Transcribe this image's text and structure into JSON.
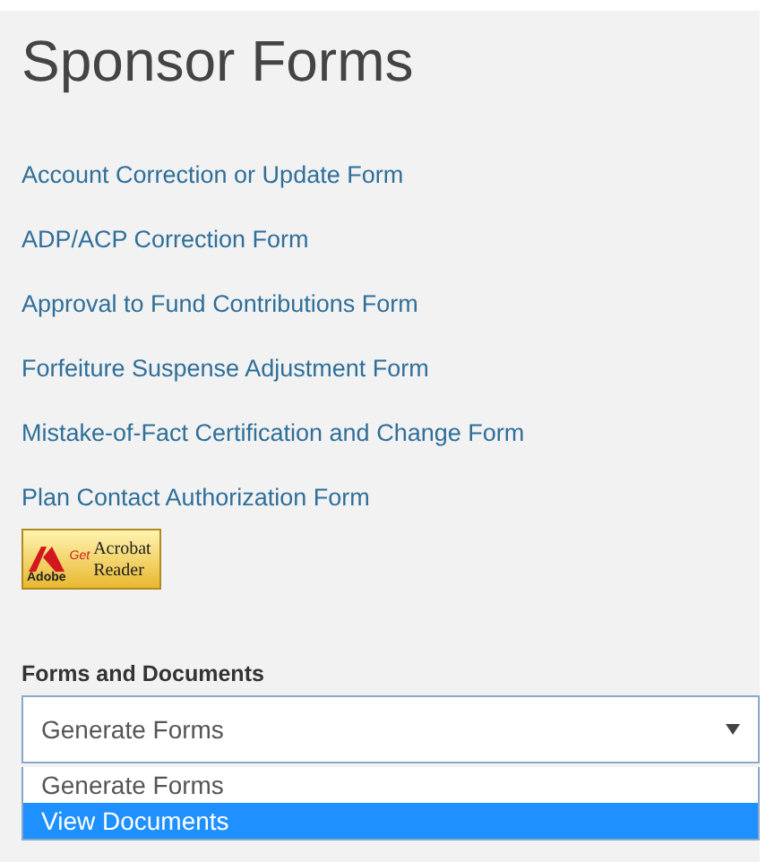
{
  "title": "Sponsor Forms",
  "links": [
    "Account Correction or Update Form",
    "ADP/ACP Correction Form",
    "Approval to Fund Contributions Form",
    "Forfeiture Suspense Adjustment Form",
    "Mistake-of-Fact Certification and Change Form",
    "Plan Contact Authorization Form"
  ],
  "reader_badge": {
    "brand": "Adobe",
    "get": "Get",
    "product_1": "Acrobat",
    "product_2": "Reader"
  },
  "dropdown": {
    "label": "Forms and Documents",
    "value": "Generate Forms",
    "expanded": true,
    "options": [
      {
        "label": "Generate Forms",
        "highlighted": false
      },
      {
        "label": "View Documents",
        "highlighted": true
      }
    ]
  }
}
